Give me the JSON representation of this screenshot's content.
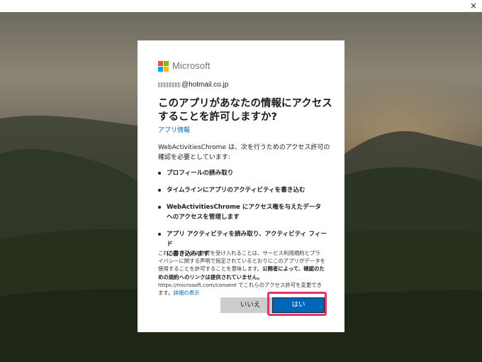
{
  "window": {
    "close_glyph": "×",
    "close_icon": "close-icon"
  },
  "brand": {
    "name": "Microsoft",
    "logo_colors": [
      "#f25022",
      "#7fba00",
      "#00a4ef",
      "#ffb900"
    ]
  },
  "account": {
    "email_suffix": "@hotmail.co.jp"
  },
  "dialog": {
    "title_line1": "このアプリがあなたの情報にアクセス",
    "title_line2": "することを許可しますか?",
    "app_info_link": "アプリ情報",
    "intro_line1": "WebActivitiesChrome は、次を行うためのアクセス許可の",
    "intro_line2": "確認を必要としています:",
    "permissions": [
      {
        "line1": "プロフィールの読み取り",
        "line2": ""
      },
      {
        "line1": "タイムラインにアプリのアクティビティを書き込む",
        "line2": ""
      },
      {
        "line1": "WebActivitiesChrome にアクセス権を与えたデータ",
        "line2": "へのアクセスを管理します"
      },
      {
        "line1": "アプリ アクティビティを読み取り、アクティビティ フィード",
        "line2": "に書き込みます"
      }
    ],
    "legal_part1": "これらのアクセス許可を受け入れることは、サービス利用規約とプライバシーに関する声明で指定されているとおりにこのアプリがデータを使用することを許可することを意味します。",
    "legal_bold": "公開者によって、確認のための規約へのリンクは提供されていません。",
    "legal_part2": "https://microsoft.com/consent でこれらのアクセス許可を変更できます。",
    "legal_link": "詳細の表示",
    "no_label": "いいえ",
    "yes_label": "はい"
  },
  "colors": {
    "accent": "#0067b8",
    "highlight": "#e8326e"
  }
}
